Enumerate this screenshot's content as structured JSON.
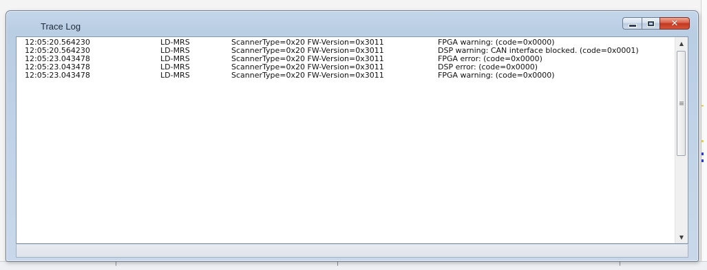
{
  "window": {
    "title": "Trace Log",
    "controls": {
      "minimize_icon": "minimize-icon",
      "maximize_icon": "maximize-icon",
      "close_icon": "close-icon",
      "close_glyph": "✕"
    }
  },
  "log": {
    "rows": [
      {
        "time": "12:05:20.564230",
        "device": "LD-MRS",
        "info": "ScannerType=0x20 FW-Version=0x3011",
        "message": "FPGA warning:  (code=0x0000)"
      },
      {
        "time": "12:05:20.564230",
        "device": "LD-MRS",
        "info": "ScannerType=0x20 FW-Version=0x3011",
        "message": "DSP warning: CAN interface blocked.  (code=0x0001)"
      },
      {
        "time": "12:05:23.043478",
        "device": "LD-MRS",
        "info": "ScannerType=0x20 FW-Version=0x3011",
        "message": "FPGA error:  (code=0x0000)"
      },
      {
        "time": "12:05:23.043478",
        "device": "LD-MRS",
        "info": "ScannerType=0x20 FW-Version=0x3011",
        "message": "DSP error:  (code=0x0000)"
      },
      {
        "time": "12:05:23.043478",
        "device": "LD-MRS",
        "info": "ScannerType=0x20 FW-Version=0x3011",
        "message": "FPGA warning:  (code=0x0000)"
      }
    ]
  },
  "scrollbar": {
    "up_icon": "scroll-up-arrow-icon",
    "down_icon": "scroll-down-arrow-icon",
    "up_glyph": "▲",
    "down_glyph": "▼"
  },
  "colors": {
    "titlebar": "#b9cde3",
    "close_button": "#c0381f",
    "content_background": "#ffffff"
  }
}
